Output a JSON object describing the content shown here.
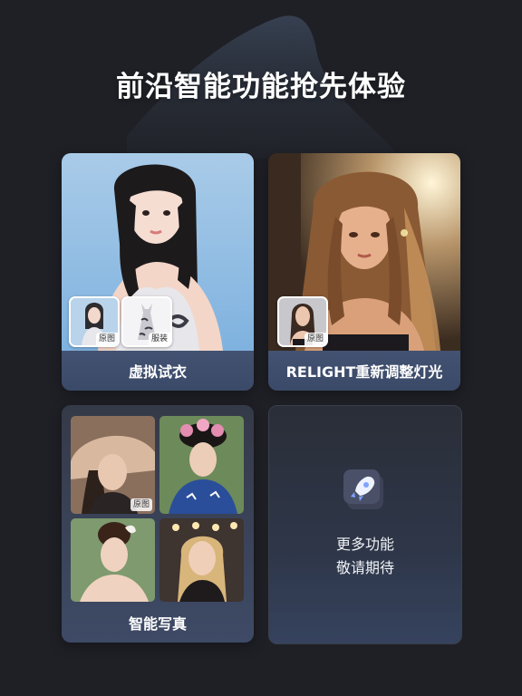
{
  "headline": "前沿智能功能抢先体验",
  "cards": {
    "tryon": {
      "label": "虚拟试衣",
      "thumb_original": "原图",
      "thumb_clothes": "服装"
    },
    "relight": {
      "label": "RELIGHT重新调整灯光",
      "thumb_original": "原图"
    },
    "portrait": {
      "label": "智能写真",
      "tile_original": "原图"
    },
    "more": {
      "line1": "更多功能",
      "line2": "敬请期待",
      "icon": "rocket-icon"
    }
  },
  "colors": {
    "background": "#1f2026",
    "card_label_bg": "#465678",
    "accent_rocket": "#7ea2ff"
  }
}
